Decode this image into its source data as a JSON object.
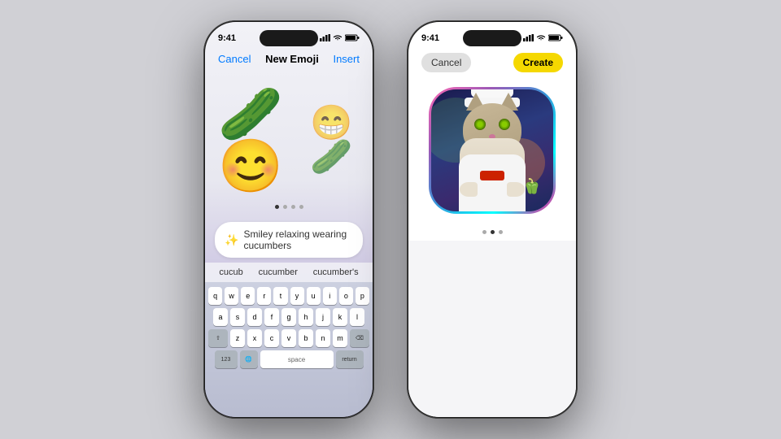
{
  "phone1": {
    "status": {
      "time": "9:41",
      "signal": "▋▋▋",
      "wifi": "wifi",
      "battery": "🔋"
    },
    "nav": {
      "cancel": "Cancel",
      "title": "New Emoji",
      "insert": "Insert"
    },
    "emoji_main": "🥒😊",
    "emoji_secondary": "😁",
    "page_dots": [
      true,
      false,
      false,
      false
    ],
    "input_text": "Smiley relaxing wearing cucumbers",
    "input_placeholder": "Smiley relaxing wearing cucumbers",
    "autocomplete": [
      "cucub",
      "cucumber",
      "cucumber's"
    ],
    "keyboard_rows": [
      [
        "q",
        "w",
        "e",
        "r",
        "t",
        "y",
        "u",
        "i",
        "o",
        "p"
      ],
      [
        "a",
        "s",
        "d",
        "f",
        "g",
        "h",
        "j",
        "k",
        "l"
      ],
      [
        "z",
        "x",
        "c",
        "v",
        "b",
        "n",
        "m"
      ]
    ]
  },
  "phone2": {
    "status": {
      "time": "9:41"
    },
    "nav": {
      "cancel": "Cancel",
      "create": "Create"
    },
    "page_dots": [
      false,
      true,
      false
    ],
    "image_alt": "AI generated chef cat image"
  }
}
